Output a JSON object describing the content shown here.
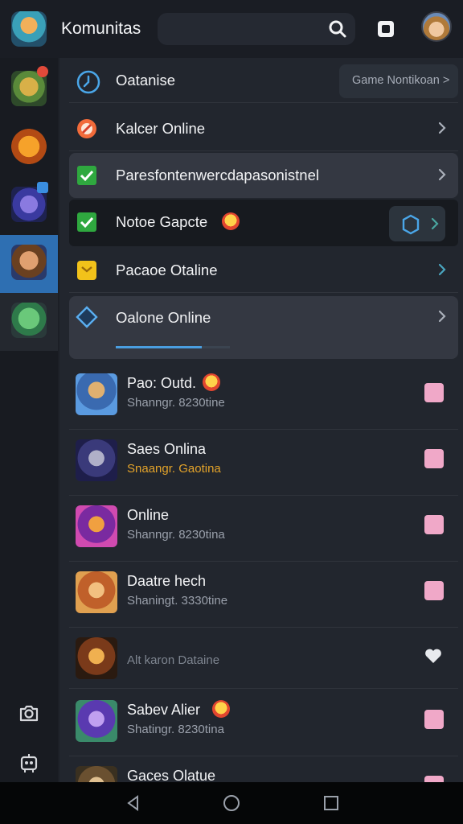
{
  "header": {
    "title": "Komunitas",
    "icons": [
      "app-icon",
      "search-icon",
      "square-icon",
      "avatar"
    ]
  },
  "menu": [
    {
      "label": "Oatanise",
      "icon": "clock-icon",
      "button": "Game Nontikoan >"
    },
    {
      "label": "Kalcer Online",
      "icon": "ban-icon"
    },
    {
      "label": "Paresfontenwercdapasonistnel",
      "icon": "green-check-icon"
    },
    {
      "label": "Notoe Gapcte",
      "icon": "green-check-icon"
    },
    {
      "label": "Pacaoe Otaline",
      "icon": "yellow-box-icon"
    },
    {
      "label": "Oalone Online",
      "icon": "diamond-icon",
      "progress": 0.75
    }
  ],
  "list": [
    {
      "title": "Pao: Outd.",
      "sub": "Shanngr. 8230tine",
      "sub_color": "gray",
      "emoji": true
    },
    {
      "title": "Saes Onlina",
      "sub": "Snaangr. Gaotina",
      "sub_color": "orange",
      "emoji": false
    },
    {
      "title": "Online",
      "sub": "Shanngr. 8230tina",
      "sub_color": "gray",
      "emoji": false
    },
    {
      "title": "Daatre hech",
      "sub": "Shaningt. 3330tine",
      "sub_color": "gray",
      "emoji": false
    },
    {
      "title": "",
      "sub": "Alt karon Dataine",
      "sub_color": "faded",
      "emoji": false,
      "action": "heart"
    },
    {
      "title": "Sabev Alier",
      "sub": "Shatingr. 8230tina",
      "sub_color": "gray",
      "emoji": true
    },
    {
      "title": "Gaces Olatue",
      "sub": "",
      "sub_color": "gray",
      "emoji": false
    }
  ],
  "colors": {
    "background": "#1c1f26",
    "panel": "#22262e",
    "accent": "#2e6fb2",
    "check_pink": "#f0a8c8",
    "orange_text": "#e3a32a"
  }
}
